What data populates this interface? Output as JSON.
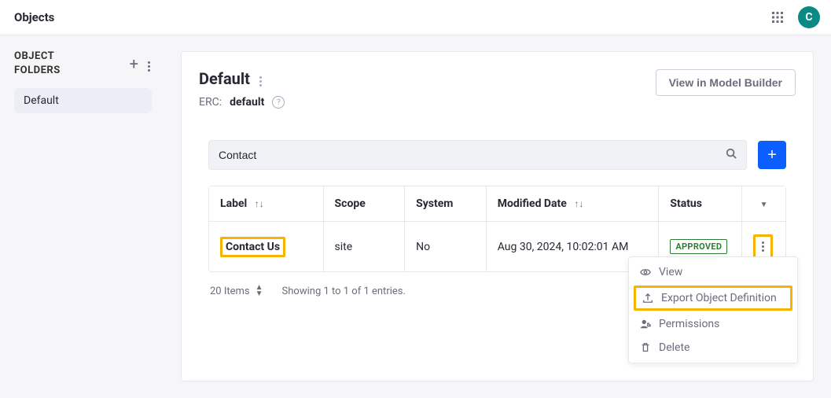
{
  "topbar": {
    "title": "Objects",
    "avatar_initial": "C"
  },
  "sidebar": {
    "heading_line1": "OBJECT",
    "heading_line2": "FOLDERS",
    "folders": [
      {
        "label": "Default"
      }
    ]
  },
  "panel": {
    "title": "Default",
    "erc_label": "ERC:",
    "erc_value": "default",
    "view_builder_btn": "View in Model Builder"
  },
  "search": {
    "value": "Contact"
  },
  "table": {
    "headers": {
      "label": "Label",
      "scope": "Scope",
      "system": "System",
      "modified": "Modified Date",
      "status": "Status"
    },
    "rows": [
      {
        "label": "Contact Us",
        "scope": "site",
        "system": "No",
        "modified": "Aug 30, 2024, 10:02:01 AM",
        "status": "APPROVED"
      }
    ]
  },
  "dropdown": {
    "view": "View",
    "export": "Export Object Definition",
    "permissions": "Permissions",
    "delete": "Delete"
  },
  "footer": {
    "per_page": "20 Items",
    "showing": "Showing 1 to 1 of 1 entries."
  }
}
